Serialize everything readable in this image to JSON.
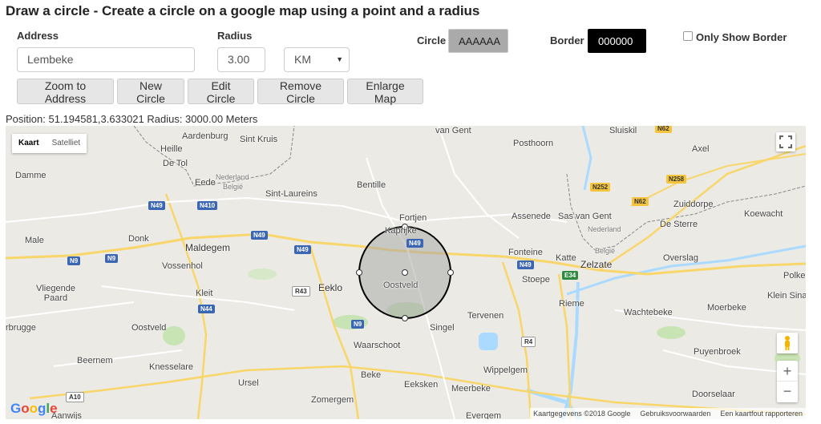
{
  "page": {
    "title": "Draw a circle - Create a circle on a google map using a point and a radius"
  },
  "form": {
    "address_label": "Address",
    "address_value": "Lembeke",
    "radius_label": "Radius",
    "radius_value": "3.00",
    "unit_value": "KM",
    "circle_label": "Circle",
    "circle_color": "AAAAAA",
    "border_label": "Border",
    "border_color": "000000",
    "only_border_label": "Only Show Border",
    "only_border_checked": false
  },
  "buttons": {
    "zoom": "Zoom to Address",
    "new": "New Circle",
    "edit": "Edit Circle",
    "remove": "Remove Circle",
    "enlarge": "Enlarge Map"
  },
  "status": {
    "position_text": "Position: 51.194581,3.633021 Radius: 3000.00 Meters"
  },
  "map": {
    "type_map": "Kaart",
    "type_satellite": "Satelliet",
    "labels": {
      "van_gent": "van Gent",
      "sluiskil": "Sluiskil",
      "aardenburg": "Aardenburg",
      "sint_kruis": "Sint Kruis",
      "posthoorn": "Posthoorn",
      "axel": "Axel",
      "heille": "Heille",
      "de_tol": "De Tol",
      "damme": "Damme",
      "eede": "Eede",
      "nederland1": "Nederland",
      "belgie1": "België",
      "sint_laureins": "Sint-Laureins",
      "bentille": "Bentille",
      "zuiddorpe": "Zuiddorpe",
      "koewacht": "Koewacht",
      "fortjen": "Fortjen",
      "assenede": "Assenede",
      "sas_van_gent": "Sas van Gent",
      "de_sterre": "De Sterre",
      "kaprijke": "Kaprijke",
      "male": "Male",
      "donk": "Donk",
      "maldegem": "Maldegem",
      "nederland2": "Nederland",
      "belgie2": "België",
      "fonteine": "Fonteine",
      "katte": "Katte",
      "zelzate": "Zelzate",
      "overslag": "Overslag",
      "vossenhol": "Vossenhol",
      "eeklo": "Eeklo",
      "oostveld1": "Oostveld",
      "stoepe": "Stoepe",
      "polke": "Polke",
      "vliegende_paard": "Vliegende\nPaard",
      "kleit": "Kleit",
      "riеme": "Rieme",
      "wachtebeke": "Wachtebeke",
      "moerbeke": "Moerbeke",
      "klein_sina": "Klein Sina",
      "tervenen": "Tervenen",
      "brugge": "rbrugge",
      "oostveld2": "Oostveld",
      "singel": "Singel",
      "waarschoot": "Waarschoot",
      "puyenbroek": "Puyenbroek",
      "beernem": "Beernem",
      "knesselare": "Knesselare",
      "wippelgem": "Wippelgem",
      "beke": "Beke",
      "ursel": "Ursel",
      "eeksken": "Eeksken",
      "meerbeke": "Meerbeke",
      "doorselaar": "Doorselaar",
      "zomergem": "Zomergem",
      "aanwijs": "Aanwijs",
      "evergem": "Evergem"
    },
    "shields": {
      "n62a": "N62",
      "n49a": "N49",
      "n410": "N410",
      "n252": "N252",
      "n62b": "N62",
      "n258": "N258",
      "n49b": "N49",
      "n49c": "N49",
      "n9a": "N9",
      "n9b": "N9",
      "n49d": "N49",
      "n49e": "N49",
      "e34": "E34",
      "n43": "R43",
      "n44": "N44",
      "n9c": "N9",
      "r4": "R4",
      "a10": "A10"
    },
    "attribution": "Kaartgegevens ©2018 Google",
    "terms": "Gebruiksvoorwaarden",
    "report": "Een kaartfout rapporteren",
    "google_logo": "Google",
    "zoom_in": "+",
    "zoom_out": "−"
  },
  "colors": {
    "circle_fill": "#AAAAAA",
    "circle_border": "#000000",
    "road_yellow": "#f8d66a",
    "road_white": "#ffffff",
    "water": "#aadaff",
    "park": "#c8e3b4"
  }
}
